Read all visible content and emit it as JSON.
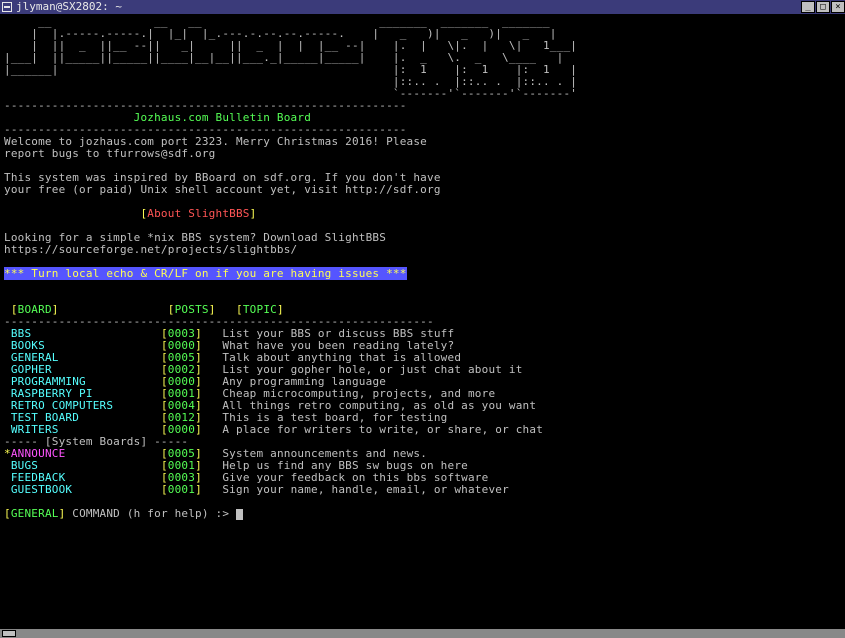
{
  "window": {
    "title": "jlyman@SX2802: ~"
  },
  "ascii_art": [
    "     __               __   __                          _______  _______  _______ ",
    "    |  |.-----.-----.|  |_|  |_.---.-.--.--.-----.    |   _   )|   _   )|   _   |",
    "    |  ||  _  ||__ --||   _|     ||  _  |  |  |__ --|    |.  |   \\|.  |   \\|   1___|",
    "|___|  ||_____||_____||____|__|__||___._|_____|_____|    |.  _   \\.  _   \\____   |",
    "|______|                                                 |:  1    |:  1    |:  1   |",
    "                                                         |::.. .  |::.. .  |::.. . |",
    "                                                         `-------'`-------'`-------'"
  ],
  "divider_top": "-----------------------------------------------------------",
  "header_tagline": "Jozhaus.com Bulletin Board",
  "divider_bot": "-----------------------------------------------------------",
  "welcome": [
    "Welcome to jozhaus.com port 2323. Merry Christmas 2016! Please",
    "report bugs to tfurrows@sdf.org",
    "",
    "This system was inspired by BBoard on sdf.org. If you don't have",
    "your free (or paid) Unix shell account yet, visit http://sdf.org"
  ],
  "about_heading": {
    "open": "[",
    "text": "About SlightBBS",
    "close": "]"
  },
  "about_body": [
    "Looking for a simple *nix BBS system? Download SlightBBS",
    "https://sourceforge.net/projects/slightbbs/"
  ],
  "echo_notice": "*** Turn local echo & CR/LF on if you are having issues ***",
  "columns": {
    "board": "BOARD",
    "posts": "POSTS",
    "topic": "TOPIC"
  },
  "table_divider": "---------------------------------------------------------------",
  "boards": [
    {
      "name": "BBS",
      "posts": "0003",
      "topic": "List your BBS or discuss BBS stuff"
    },
    {
      "name": "BOOKS",
      "posts": "0000",
      "topic": "What have you been reading lately?"
    },
    {
      "name": "GENERAL",
      "posts": "0005",
      "topic": "Talk about anything that is allowed"
    },
    {
      "name": "GOPHER",
      "posts": "0002",
      "topic": "List your gopher hole, or just chat about it"
    },
    {
      "name": "PROGRAMMING",
      "posts": "0000",
      "topic": "Any programming language"
    },
    {
      "name": "RASPBERRY PI",
      "posts": "0001",
      "topic": "Cheap microcomputing, projects, and more"
    },
    {
      "name": "RETRO COMPUTERS",
      "posts": "0004",
      "topic": "All things retro computing, as old as you want"
    },
    {
      "name": "TEST BOARD",
      "posts": "0012",
      "topic": "This is a test board, for testing"
    },
    {
      "name": "WRITERS",
      "posts": "0000",
      "topic": "A place for writers to write, or share, or chat"
    }
  ],
  "sys_divider": "----- [System Boards] -----",
  "sys_boards": [
    {
      "star": "*",
      "name": "ANNOUNCE",
      "color": "magenta",
      "posts": "0005",
      "topic": "System announcements and news."
    },
    {
      "star": " ",
      "name": "BUGS",
      "color": "cyan",
      "posts": "0001",
      "topic": "Help us find any BBS sw bugs on here"
    },
    {
      "star": " ",
      "name": "FEEDBACK",
      "color": "cyan",
      "posts": "0003",
      "topic": "Give your feedback on this bbs software"
    },
    {
      "star": " ",
      "name": "GUESTBOOK",
      "color": "cyan",
      "posts": "0001",
      "topic": "Sign your name, handle, email, or whatever"
    }
  ],
  "prompt": {
    "open": "[",
    "board": "GENERAL",
    "close": "]",
    "text": " COMMAND (h for help) :> "
  }
}
